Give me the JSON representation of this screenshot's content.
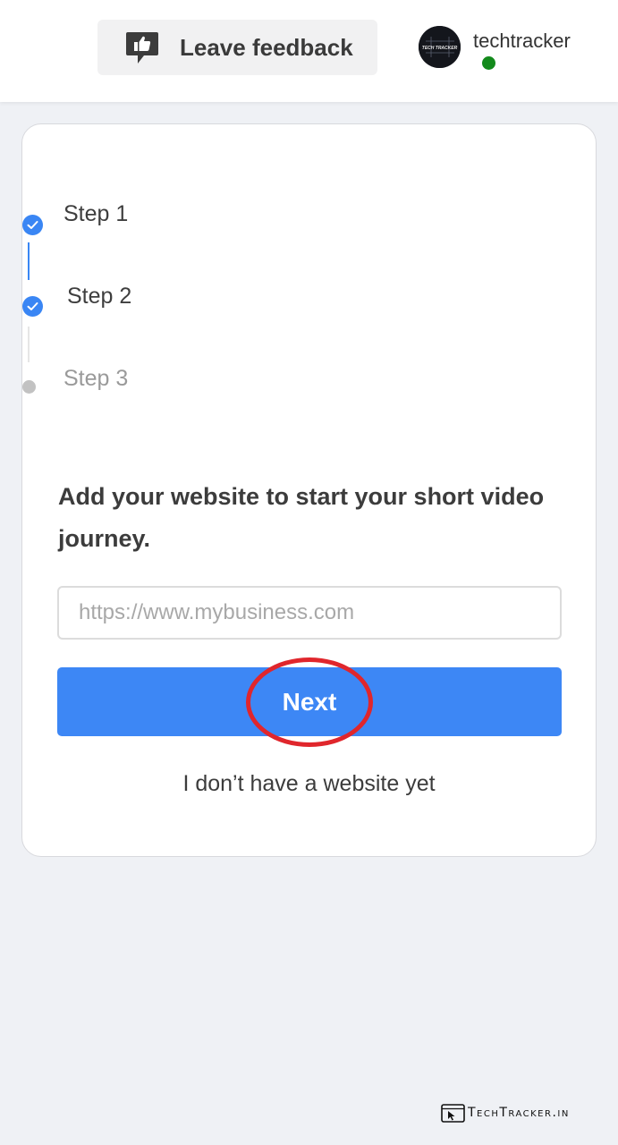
{
  "header": {
    "feedback_label": "Leave feedback",
    "username": "techtracker",
    "avatar_text": "TECH TRACKER",
    "status_color": "#138a1c"
  },
  "stepper": {
    "steps": [
      {
        "label": "Step 1",
        "state": "completed"
      },
      {
        "label": "Step 2",
        "state": "completed"
      },
      {
        "label": "Step 3",
        "state": "pending"
      }
    ],
    "active_color": "#3a86f4",
    "pending_color": "#c2c2c2"
  },
  "form": {
    "heading": "Add your website to start your short video journey.",
    "url_input": {
      "value": "",
      "placeholder": "https://www.mybusiness.com"
    },
    "next_label": "Next",
    "no_website_label": "I don’t have a website yet"
  },
  "watermark": {
    "text": "TechTracker.in"
  },
  "colors": {
    "primary": "#3d87f5",
    "highlight": "#e0262c",
    "background": "#eff1f5"
  }
}
